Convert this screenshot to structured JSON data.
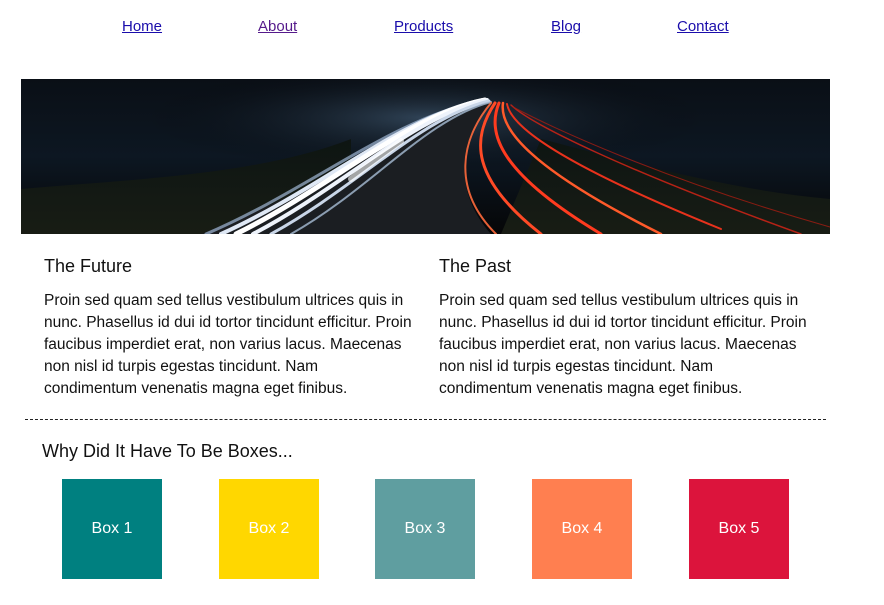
{
  "nav": {
    "items": [
      {
        "label": "Home"
      },
      {
        "label": "About"
      },
      {
        "label": "Products"
      },
      {
        "label": "Blog"
      },
      {
        "label": "Contact"
      }
    ]
  },
  "hero": {
    "description_icon": "highway-light-trails-image"
  },
  "columns": [
    {
      "heading": "The Future",
      "body": "Proin sed quam sed tellus vestibulum ultrices quis in nunc. Phasellus id dui id tortor tincidunt efficitur. Proin faucibus imperdiet erat, non varius lacus. Maecenas non nisl id turpis egestas tincidunt. Nam condimentum venenatis magna eget finibus."
    },
    {
      "heading": "The Past",
      "body": "Proin sed quam sed tellus vestibulum ultrices quis in nunc. Phasellus id dui id tortor tincidunt efficitur. Proin faucibus imperdiet erat, non varius lacus. Maecenas non nisl id turpis egestas tincidunt. Nam condimentum venenatis magna eget finibus."
    }
  ],
  "boxes_section": {
    "title": "Why Did It Have To Be Boxes...",
    "boxes": [
      {
        "label": "Box 1",
        "color": "#008080"
      },
      {
        "label": "Box 2",
        "color": "#ffd700"
      },
      {
        "label": "Box 3",
        "color": "#5f9ea0"
      },
      {
        "label": "Box 4",
        "color": "#ff7f50"
      },
      {
        "label": "Box 5",
        "color": "#dc143c"
      }
    ]
  }
}
